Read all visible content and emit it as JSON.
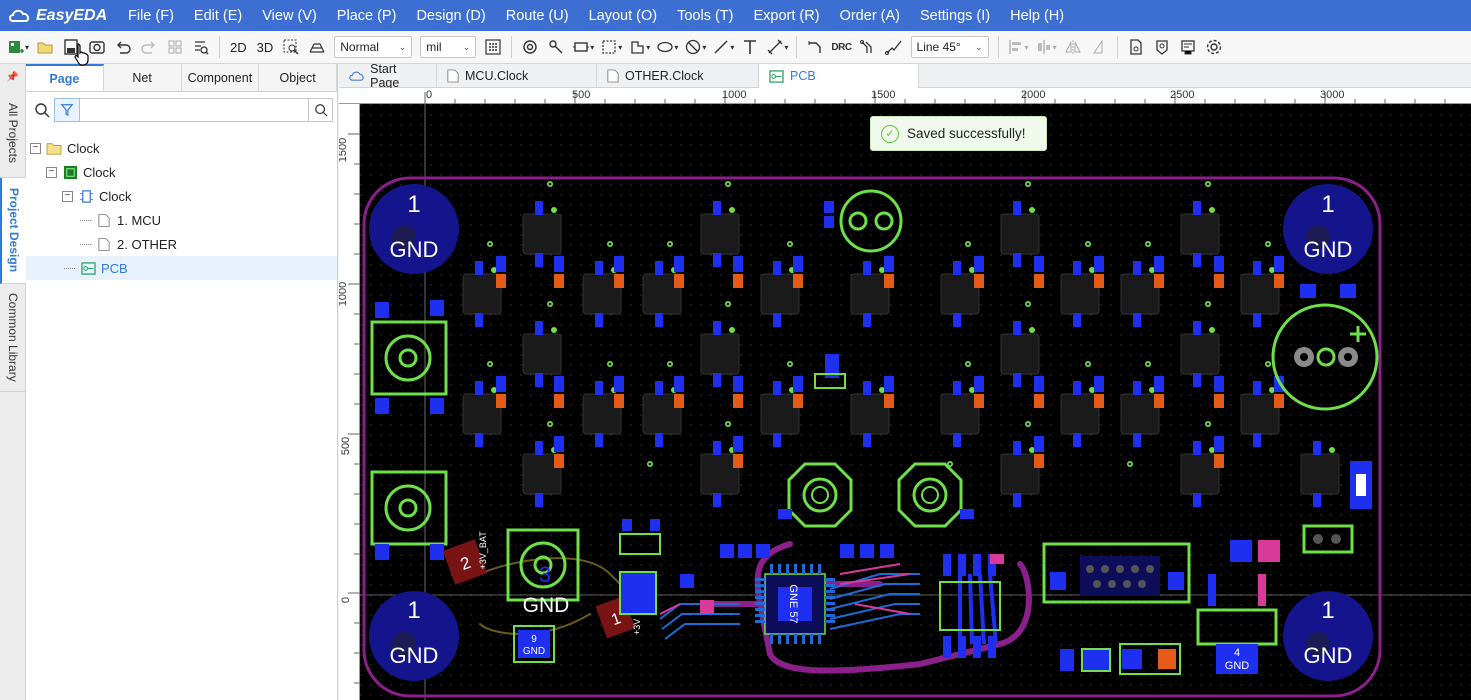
{
  "app": {
    "name": "EasyEDA"
  },
  "menu": [
    "File (F)",
    "Edit (E)",
    "View (V)",
    "Place (P)",
    "Design (D)",
    "Route (U)",
    "Layout (O)",
    "Tools (T)",
    "Export (R)",
    "Order (A)",
    "Settings (I)",
    "Help (H)"
  ],
  "toolbar": {
    "view_2d": "2D",
    "view_3d": "3D",
    "mode_select": "Normal",
    "unit_select": "mil",
    "drc": "DRC",
    "line_mode": "Line 45°"
  },
  "sidebar_tabs": [
    "All Projects",
    "Project Design",
    "Common Library"
  ],
  "panel_tabs": [
    "Page",
    "Net",
    "Component",
    "Object"
  ],
  "search": {
    "placeholder": ""
  },
  "tree": [
    {
      "label": "Clock",
      "icon": "folder-icon"
    },
    {
      "label": "Clock",
      "icon": "board-icon"
    },
    {
      "label": "Clock",
      "icon": "schematic-icon"
    },
    {
      "label": "1. MCU",
      "icon": "page-icon"
    },
    {
      "label": "2. OTHER",
      "icon": "page-icon"
    },
    {
      "label": "PCB",
      "icon": "pcb-icon"
    }
  ],
  "doc_tabs": [
    {
      "label": "Start Page",
      "icon": "cloud-icon"
    },
    {
      "label": "MCU.Clock",
      "icon": "page-icon"
    },
    {
      "label": "OTHER.Clock",
      "icon": "page-icon"
    },
    {
      "label": "PCB",
      "icon": "pcb-icon"
    }
  ],
  "ruler": {
    "top": [
      "0",
      "500",
      "1000",
      "1500",
      "2000",
      "2500",
      "3000"
    ],
    "left": [
      "1500",
      "1000",
      "500",
      "0"
    ]
  },
  "toast": {
    "message": "Saved successfully!"
  },
  "pcb_labels": {
    "corner_pin": "1",
    "corner_net": "GND",
    "bat_pin_2": "2",
    "bat_pin_1": "1",
    "bat_net": "+3V_BAT",
    "bat_net_short": "+3V",
    "button_pin": "3",
    "pad_9": "9",
    "pad_4": "4",
    "chip_text": "GNE 57"
  },
  "colors": {
    "menubar": "#3c6fd1",
    "board_outline": "#8b1f8b",
    "top_pads": "#e8262a",
    "bottom_pads": "#1f2ff0",
    "silk": "#6de04a",
    "mounting_hole": "#14148c"
  }
}
